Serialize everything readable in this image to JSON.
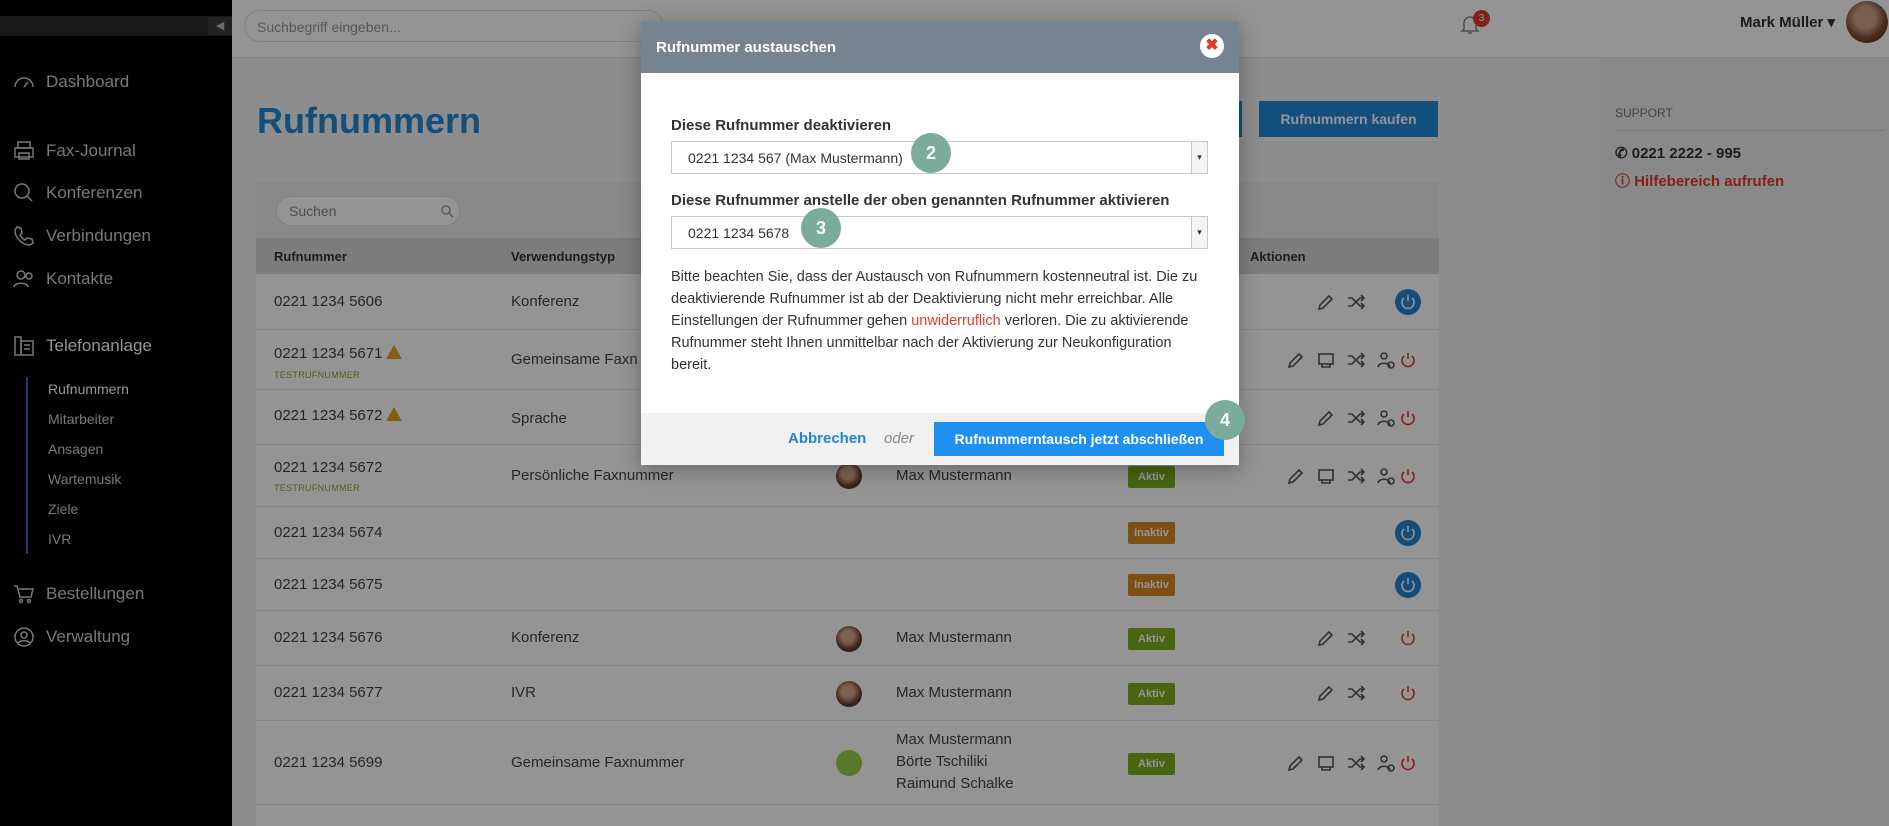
{
  "sidebar": {
    "collapse_glyph": "◀",
    "items": [
      {
        "label": "Dashboard",
        "icon": "gauge-icon"
      },
      {
        "label": "Fax-Journal",
        "icon": "printer-icon"
      },
      {
        "label": "Konferenzen",
        "icon": "chat-icon"
      },
      {
        "label": "Verbindungen",
        "icon": "phone-icon"
      },
      {
        "label": "Kontakte",
        "icon": "contacts-icon"
      },
      {
        "label": "Telefonanlage",
        "icon": "pbx-icon"
      },
      {
        "label": "Bestellungen",
        "icon": "cart-icon"
      },
      {
        "label": "Verwaltung",
        "icon": "user-icon"
      }
    ],
    "subitems": [
      "Rufnummern",
      "Mitarbeiter",
      "Ansagen",
      "Wartemusik",
      "Ziele",
      "IVR"
    ]
  },
  "topbar": {
    "search_placeholder": "Suchbegriff eingeben...",
    "notification_count": "3",
    "user_name": "Mark Müller ▾"
  },
  "main": {
    "title": "Rufnummern",
    "buy_button": "Rufnummern kaufen",
    "search_placeholder": "Suchen",
    "columns": {
      "number": "Rufnummer",
      "usage": "Verwendungstyp",
      "actions": "Aktionen"
    },
    "rows": [
      {
        "number": "0221 1234 5606",
        "usage": "Konferenz",
        "names": "",
        "status": "",
        "test": ""
      },
      {
        "number": "0221 1234 5671",
        "usage": "Gemeinsame Faxn",
        "names": "",
        "status": "",
        "test": "TESTRUFNUMMER"
      },
      {
        "number": "0221 1234 5672",
        "usage": "Sprache",
        "names": "",
        "status": "",
        "test": ""
      },
      {
        "number": "0221 1234 5672",
        "usage": "Persönliche Faxnummer",
        "names": "Max Mustermann",
        "status": "Aktiv",
        "test": "TESTRUFNUMMER"
      },
      {
        "number": "0221 1234 5674",
        "usage": "",
        "names": "",
        "status": "Inaktiv",
        "test": ""
      },
      {
        "number": "0221 1234 5675",
        "usage": "",
        "names": "",
        "status": "Inaktiv",
        "test": ""
      },
      {
        "number": "0221 1234 5676",
        "usage": "Konferenz",
        "names": "Max Mustermann",
        "status": "Aktiv",
        "test": ""
      },
      {
        "number": "0221 1234 5677",
        "usage": "IVR",
        "names": "Max Mustermann",
        "status": "Aktiv",
        "test": ""
      },
      {
        "number": "0221 1234 5699",
        "usage": "Gemeinsame Faxnummer",
        "names": "Max Mustermann\nBörte Tschiliki\nRaimund Schalke",
        "status": "Aktiv",
        "test": ""
      }
    ]
  },
  "support": {
    "header": "SUPPORT",
    "phone": "0221 2222 - 995",
    "help": "Hilfebereich aufrufen"
  },
  "modal": {
    "title": "Rufnummer austauschen",
    "close_glyph": "✖",
    "label_deactivate": "Diese Rufnummer deaktivieren",
    "select_deactivate": "0221 1234 567 (Max Mustermann)",
    "label_activate": "Diese Rufnummer anstelle der oben genannten Rufnummer aktivieren",
    "select_activate": "0221 1234 5678",
    "info_part1": "Bitte beachten Sie, dass der Austausch von Rufnummern kostenneutral ist. Die zu deaktivierende Rufnummer ist ab der Deaktivierung nicht mehr erreichbar. Alle Einstellungen der Rufnummer gehen ",
    "info_red": "unwiderruflich",
    "info_part2": " verloren. Die zu aktivierende Rufnummer steht Ihnen unmittelbar nach der Aktivierung zur Neukonfiguration bereit.",
    "cancel": "Abbrechen",
    "or": "oder",
    "confirm": "Rufnummerntausch jetzt abschließen"
  },
  "steps": [
    "2",
    "3",
    "4"
  ],
  "colors": {
    "accent": "#1f88d4",
    "danger": "#e23b2e",
    "active": "#7fae1d",
    "inactive": "#d8891f",
    "step": "#7aab9b"
  }
}
